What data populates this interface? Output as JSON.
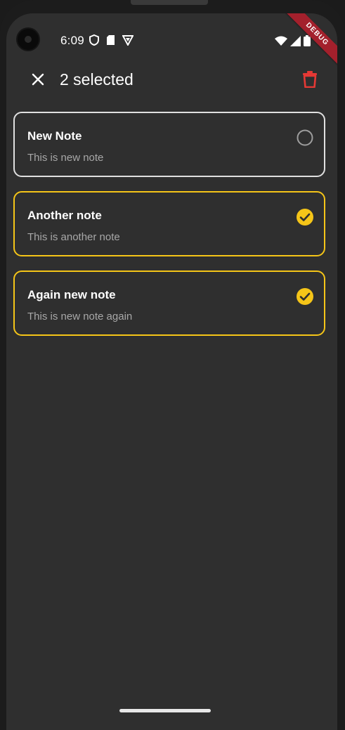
{
  "status_bar": {
    "time": "6:09",
    "left_icons": [
      "shield-icon",
      "sd-card-icon",
      "vpn-icon"
    ],
    "right_icons": [
      "wifi-icon",
      "cell-signal-icon",
      "battery-icon"
    ]
  },
  "debug_banner": {
    "label": "DEBUG",
    "color": "#a3202c"
  },
  "app_bar": {
    "close_icon": "close-icon",
    "title": "2 selected",
    "delete_icon": "trash-icon",
    "delete_color": "#e53935"
  },
  "notes": [
    {
      "title": "New Note",
      "body": "This is new note",
      "selected": false
    },
    {
      "title": "Another note",
      "body": "This is another note",
      "selected": true
    },
    {
      "title": "Again new note",
      "body": "This is new note again",
      "selected": true
    }
  ],
  "colors": {
    "background": "#2f2f2f",
    "accent": "#f5c518",
    "unselected_border": "#e0e0e0",
    "body_text": "#a8a8a8"
  }
}
